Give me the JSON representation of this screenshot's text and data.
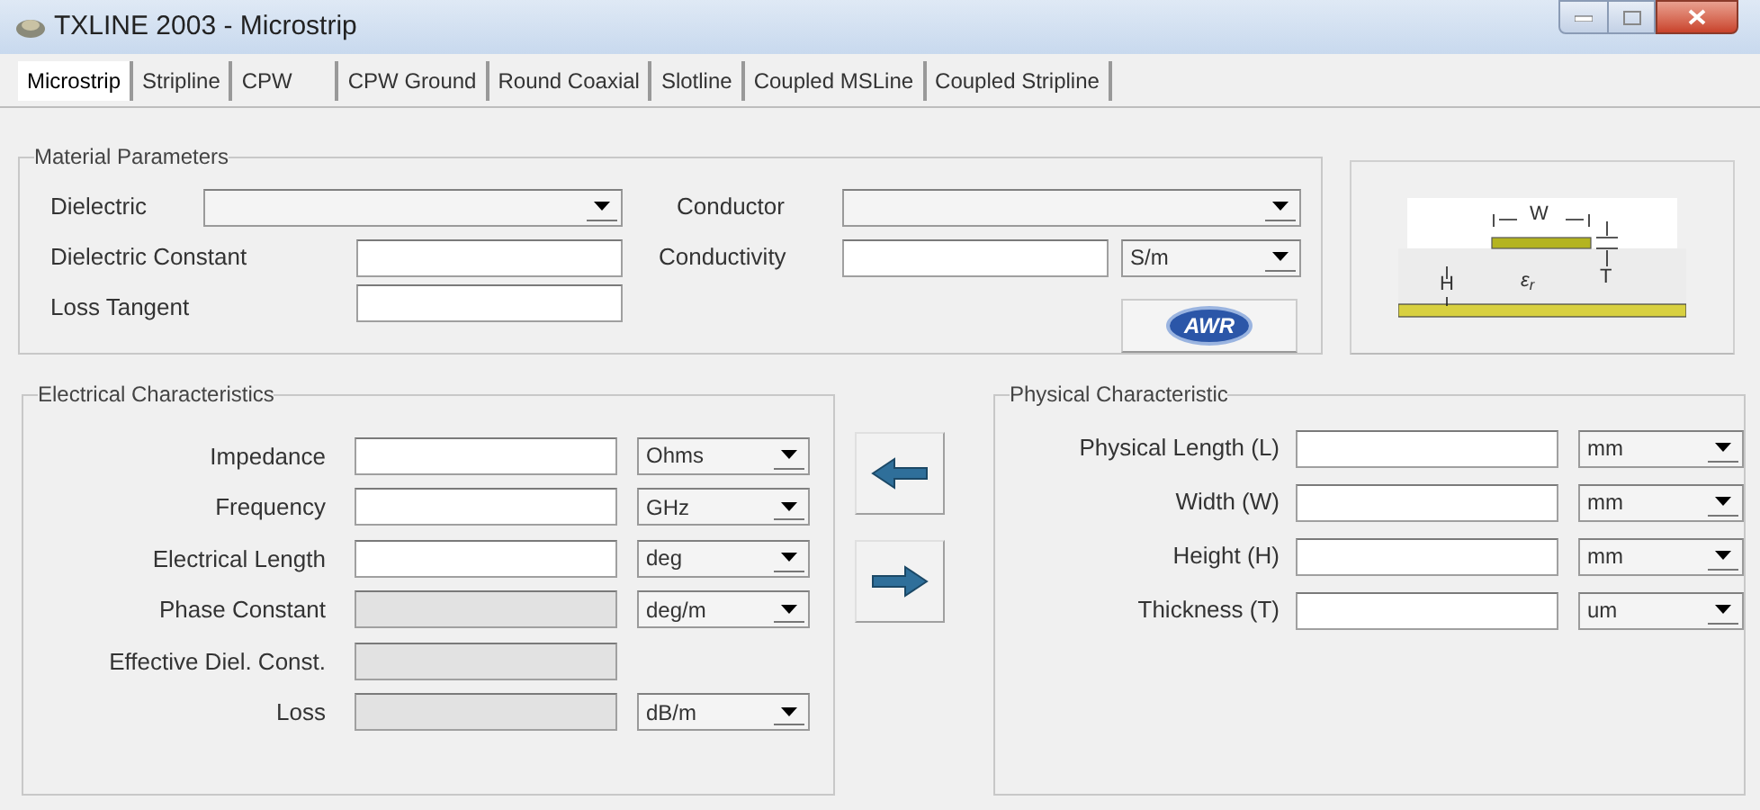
{
  "window": {
    "title": "TXLINE 2003 - Microstrip"
  },
  "tabs": [
    {
      "label": "Microstrip",
      "selected": true
    },
    {
      "label": "Stripline",
      "selected": false
    },
    {
      "label": "CPW",
      "selected": false
    },
    {
      "label": "CPW Ground",
      "selected": false
    },
    {
      "label": "Round Coaxial",
      "selected": false
    },
    {
      "label": "Slotline",
      "selected": false
    },
    {
      "label": "Coupled MSLine",
      "selected": false
    },
    {
      "label": "Coupled Stripline",
      "selected": false
    }
  ],
  "material": {
    "title": "Material Parameters",
    "dielectric_label": "Dielectric",
    "conductor_label": "Conductor",
    "dielectric_constant_label": "Dielectric Constant",
    "conductivity_label": "Conductivity",
    "conductivity_unit": "S/m",
    "loss_tangent_label": "Loss Tangent",
    "logo_button": "AWR"
  },
  "diagram": {
    "width_label": "W",
    "height_label": "H",
    "thickness_label": "T",
    "permittivity_label": "ε$_{r}$"
  },
  "electrical": {
    "title": "Electrical Characteristics",
    "rows": [
      {
        "label": "Impedance",
        "disabled": false,
        "unit": "Ohms"
      },
      {
        "label": "Frequency",
        "disabled": false,
        "unit": "GHz"
      },
      {
        "label": "Electrical Length",
        "disabled": false,
        "unit": "deg"
      },
      {
        "label": "Phase Constant",
        "disabled": true,
        "unit": "deg/m"
      },
      {
        "label": "Effective Diel. Const.",
        "disabled": true
      },
      {
        "label": "Loss",
        "disabled": true,
        "unit": "dB/m"
      }
    ]
  },
  "physical": {
    "title": "Physical Characteristic",
    "rows": [
      {
        "label": "Physical Length (L)",
        "disabled": false,
        "unit": "mm"
      },
      {
        "label": "Width (W)",
        "disabled": false,
        "unit": "mm"
      },
      {
        "label": "Height (H)",
        "disabled": false,
        "unit": "mm"
      },
      {
        "label": "Thickness (T)",
        "disabled": false,
        "unit": "um"
      }
    ]
  }
}
